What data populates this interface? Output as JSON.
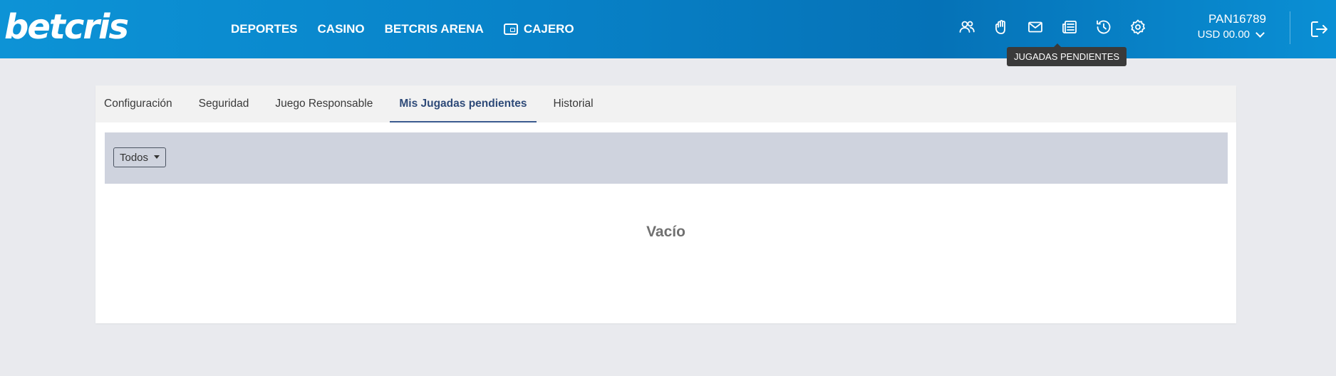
{
  "brand": {
    "logo_text": "betcris",
    "header_gradient": [
      "#0d93d6",
      "#0572b7"
    ]
  },
  "nav": [
    {
      "label": "DEPORTES"
    },
    {
      "label": "CASINO"
    },
    {
      "label": "BETCRIS ARENA"
    },
    {
      "label": "CAJERO",
      "icon": "wallet-icon"
    }
  ],
  "header_icons": [
    "users-icon",
    "hand-icon",
    "mail-icon",
    "news-icon",
    "history-icon",
    "gear-icon"
  ],
  "tooltip": {
    "text": "JUGADAS PENDIENTES"
  },
  "account": {
    "username": "PAN16789",
    "balance": "USD 00.00"
  },
  "tabs": [
    {
      "label": "Configuración",
      "active": false
    },
    {
      "label": "Seguridad",
      "active": false
    },
    {
      "label": "Juego Responsable",
      "active": false
    },
    {
      "label": "Mis Jugadas pendientes",
      "active": true
    },
    {
      "label": "Historial",
      "active": false
    }
  ],
  "filter": {
    "selected": "Todos"
  },
  "empty_state": {
    "text": "Vacío"
  }
}
